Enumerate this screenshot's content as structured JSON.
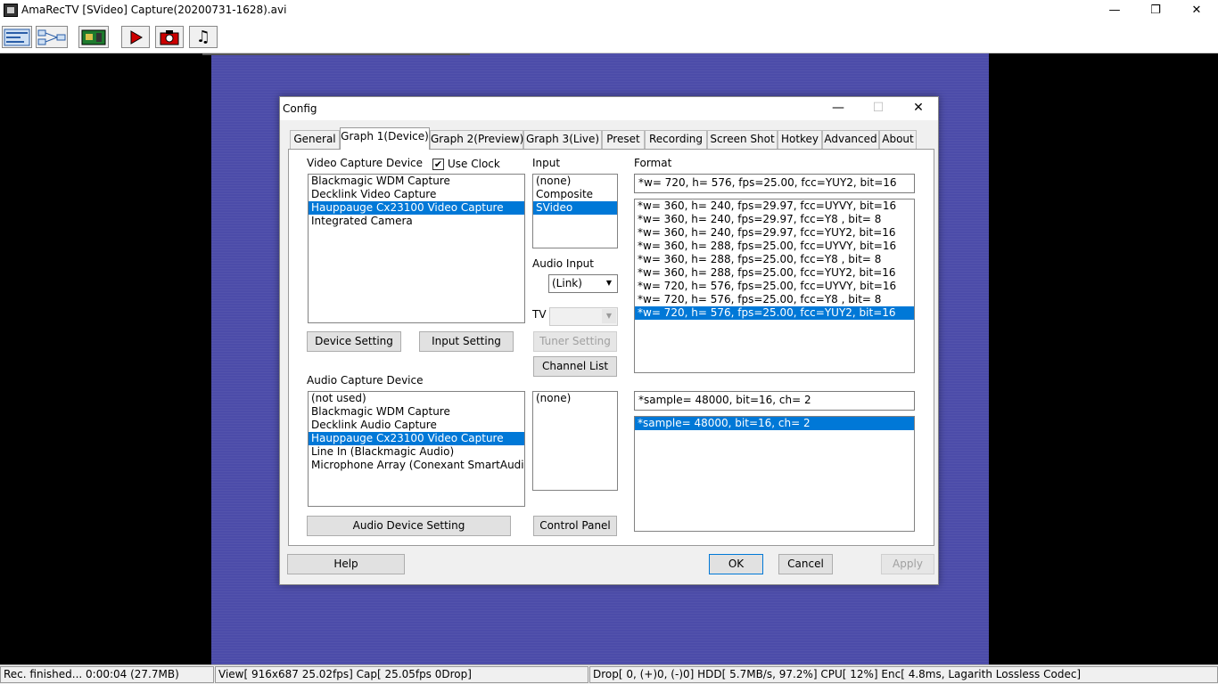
{
  "window": {
    "title": "AmaRecTV  [SVideo]  Capture(20200731-1628).avi",
    "minimize_glyph": "—",
    "restore_glyph": "❐",
    "close_glyph": "✕"
  },
  "toolbar": {
    "buttons": [
      {
        "name": "config-icon"
      },
      {
        "name": "graph-icon"
      },
      {
        "name": "device-card-icon"
      },
      {
        "name": "play-icon",
        "glyph": "▶",
        "color": "#cc0000"
      },
      {
        "name": "camera-icon",
        "color": "#cc0000"
      },
      {
        "name": "music-note-icon",
        "glyph": "♫"
      }
    ]
  },
  "video": {
    "color": "#4c4ca9"
  },
  "statusbar": {
    "rec": "Rec. finished... 0:00:04 (27.7MB)",
    "view": "View[ 916x687 25.02fps]  Cap[ 25.05fps 0Drop]",
    "drop": "Drop[   0, (+)0, (-)0]  HDD[ 5.7MB/s, 97.2%]  CPU[ 12%]  Enc[ 4.8ms, Lagarith Lossless Codec]"
  },
  "dialog": {
    "title": "Config",
    "minimize_glyph": "—",
    "maximize_glyph": "☐",
    "close_glyph": "✕",
    "tabs": [
      {
        "label": "General"
      },
      {
        "label": "Graph 1(Device)",
        "active": true
      },
      {
        "label": "Graph 2(Preview)"
      },
      {
        "label": "Graph 3(Live)"
      },
      {
        "label": "Preset"
      },
      {
        "label": "Recording"
      },
      {
        "label": "Screen Shot"
      },
      {
        "label": "Hotkey"
      },
      {
        "label": "Advanced"
      },
      {
        "label": "About"
      }
    ],
    "video_capture": {
      "label": "Video Capture Device",
      "use_clock_label": "Use Clock",
      "use_clock_checked": true,
      "devices": [
        "Blackmagic WDM Capture",
        "Decklink Video Capture",
        "Hauppauge Cx23100 Video Capture",
        "Integrated Camera"
      ],
      "selected_index": 2,
      "device_setting_label": "Device Setting",
      "input_setting_label": "Input Setting"
    },
    "input": {
      "label": "Input",
      "items": [
        "(none)",
        "Composite",
        "SVideo"
      ],
      "selected_index": 2,
      "audio_input_label": "Audio Input",
      "audio_input_value": "(Link)",
      "tv_label": "TV",
      "tv_value": "",
      "tuner_setting_label": "Tuner Setting",
      "channel_list_label": "Channel List"
    },
    "format": {
      "label": "Format",
      "current": "*w= 720, h= 576, fps=25.00,  fcc=YUY2, bit=16",
      "items": [
        "*w= 360, h= 240, fps=29.97,  fcc=UYVY, bit=16",
        "*w= 360, h= 240, fps=29.97,  fcc=Y8  , bit= 8",
        "*w= 360, h= 240, fps=29.97,  fcc=YUY2, bit=16",
        "*w= 360, h= 288, fps=25.00,  fcc=UYVY, bit=16",
        "*w= 360, h= 288, fps=25.00,  fcc=Y8  , bit= 8",
        "*w= 360, h= 288, fps=25.00,  fcc=YUY2, bit=16",
        "*w= 720, h= 576, fps=25.00,  fcc=UYVY, bit=16",
        "*w= 720, h= 576, fps=25.00,  fcc=Y8  , bit= 8",
        "*w= 720, h= 576, fps=25.00,  fcc=YUY2, bit=16"
      ],
      "selected_index": 8
    },
    "audio_capture": {
      "label": "Audio Capture Device",
      "devices": [
        "(not used)",
        "Blackmagic WDM Capture",
        "Decklink Audio Capture",
        "Hauppauge Cx23100 Video Capture",
        "Line In (Blackmagic Audio)",
        "Microphone Array (Conexant SmartAudio HD"
      ],
      "selected_index": 3,
      "audio_device_setting_label": "Audio Device Setting"
    },
    "audio_input_list": {
      "items": [
        "(none)"
      ],
      "control_panel_label": "Control Panel"
    },
    "audio_format": {
      "current": "*sample= 48000, bit=16, ch= 2",
      "items": [
        "*sample= 48000, bit=16, ch= 2"
      ],
      "selected_index": 0
    },
    "buttons": {
      "help": "Help",
      "ok": "OK",
      "cancel": "Cancel",
      "apply": "Apply"
    }
  }
}
